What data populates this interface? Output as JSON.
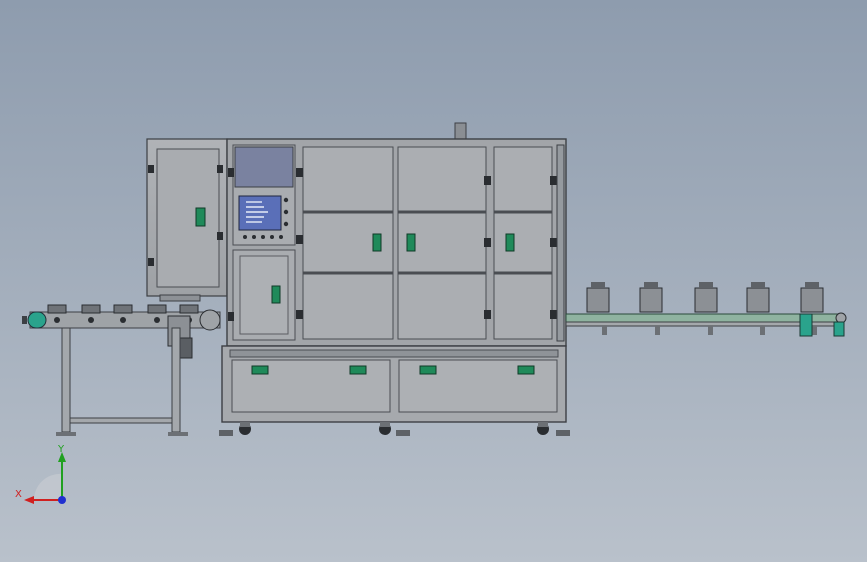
{
  "viewport": {
    "background_top": "#8e9cae",
    "background_bottom": "#b9c1cb"
  },
  "machine": {
    "frame_color": "#9a9ea4",
    "panel_color": "#a7aaae",
    "outline_color": "#3c3f44",
    "handle_color": "#1f8a5a",
    "hmi_color": "#5a6fb8",
    "conveyor_accent": "#2aa38c"
  },
  "triad": {
    "x_label": "X",
    "y_label": "Y",
    "x_color": "#d02020",
    "y_color": "#20a020",
    "z_color": "#2030d0"
  }
}
